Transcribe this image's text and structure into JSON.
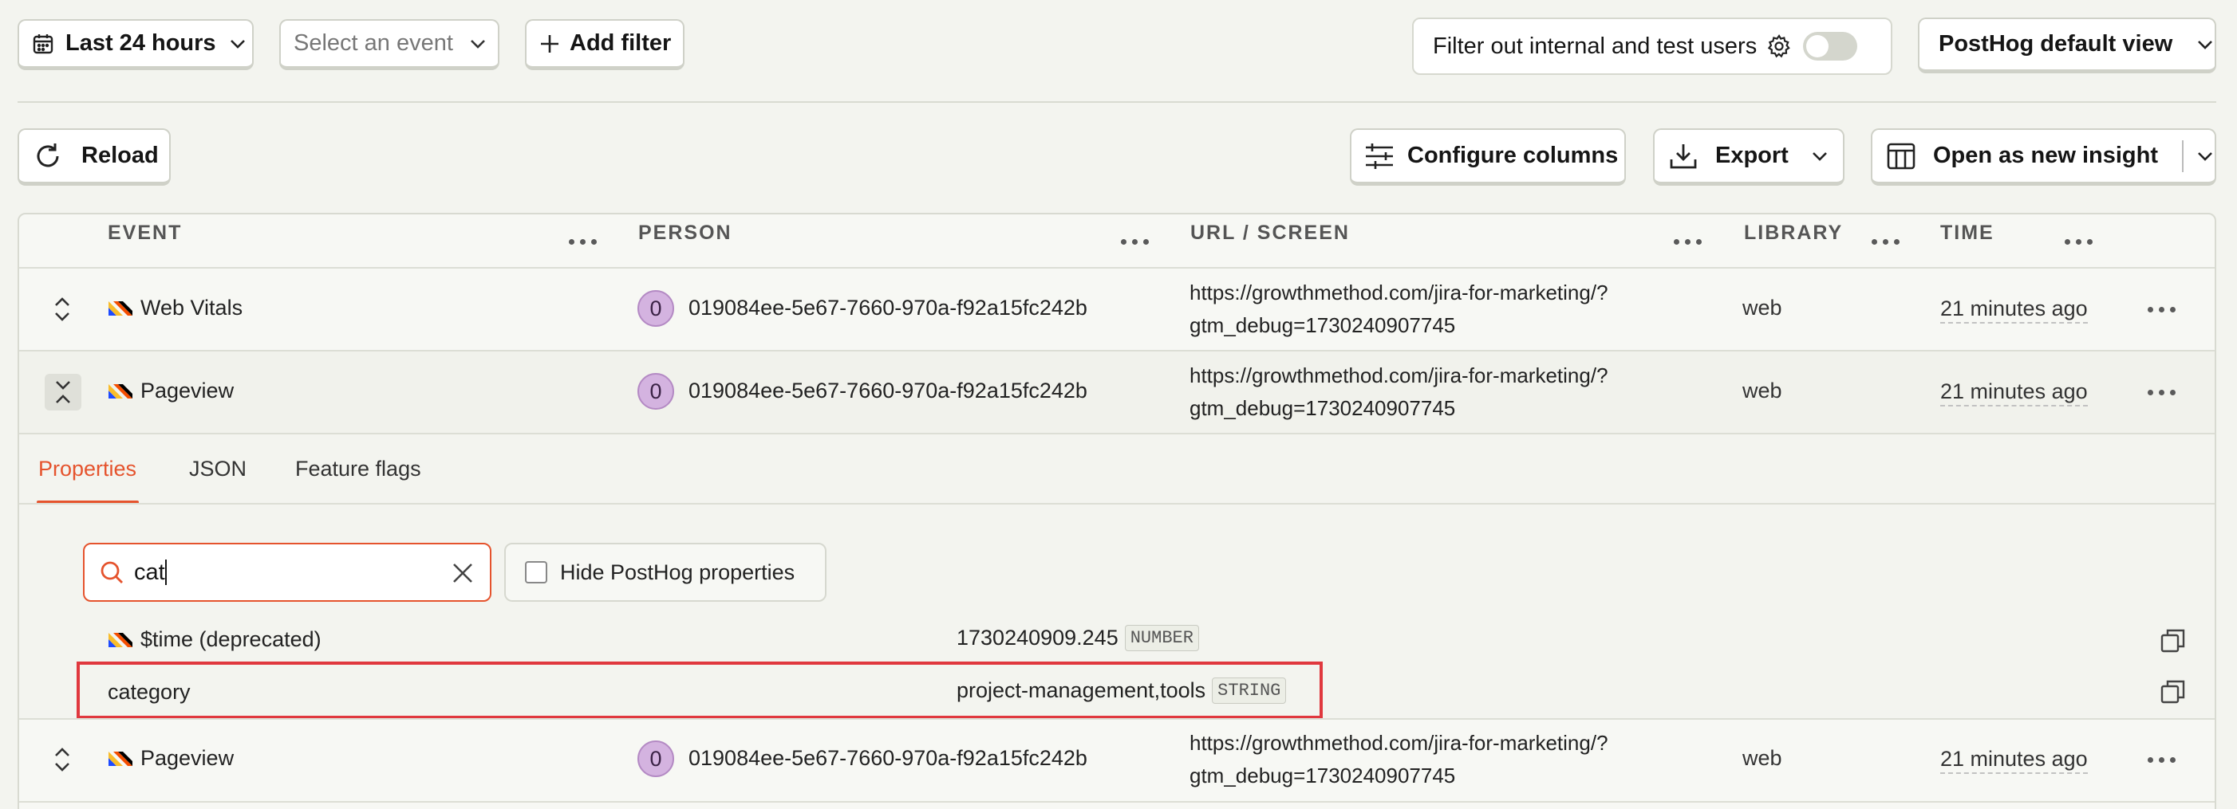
{
  "toolbar": {
    "date_range_label": "Last 24 hours",
    "event_select_placeholder": "Select an event",
    "add_filter_label": "Add filter",
    "filter_internal_label": "Filter out internal and test users",
    "view_label": "PostHog default view"
  },
  "actions": {
    "reload_label": "Reload",
    "configure_columns_label": "Configure columns",
    "export_label": "Export",
    "open_insight_label": "Open as new insight"
  },
  "table": {
    "headers": {
      "event": "EVENT",
      "person": "PERSON",
      "url": "URL / SCREEN",
      "library": "LIBRARY",
      "time": "TIME"
    },
    "rows": [
      {
        "event": "Web Vitals",
        "avatar": "0",
        "person": "019084ee-5e67-7660-970a-f92a15fc242b",
        "url_line1": "https://growthmethod.com/jira-for-marketing/?",
        "url_line2": "gtm_debug=1730240907745",
        "library": "web",
        "time": "21 minutes ago"
      },
      {
        "event": "Pageview",
        "avatar": "0",
        "person": "019084ee-5e67-7660-970a-f92a15fc242b",
        "url_line1": "https://growthmethod.com/jira-for-marketing/?",
        "url_line2": "gtm_debug=1730240907745",
        "library": "web",
        "time": "21 minutes ago"
      },
      {
        "event": "Pageview",
        "avatar": "0",
        "person": "019084ee-5e67-7660-970a-f92a15fc242b",
        "url_line1": "https://growthmethod.com/jira-for-marketing/?",
        "url_line2": "gtm_debug=1730240907745",
        "library": "web",
        "time": "21 minutes ago"
      }
    ]
  },
  "detail": {
    "tabs": [
      "Properties",
      "JSON",
      "Feature flags"
    ],
    "active_tab": "Properties",
    "search_value": "cat",
    "hide_posthog_label": "Hide PostHog properties",
    "properties": [
      {
        "name": "$time (deprecated)",
        "value": "1730240909.245",
        "type": "NUMBER"
      },
      {
        "name": "category",
        "value": "project-management,tools",
        "type": "STRING"
      }
    ]
  },
  "colors": {
    "accent": "#e5532d",
    "highlight_box": "#e0383e",
    "avatar_bg": "#d4b3e0"
  },
  "icons": [
    "calendar-icon",
    "chevron-down-icon",
    "plus-icon",
    "gear-icon",
    "toggle-switch",
    "reload-icon",
    "sliders-icon",
    "download-icon",
    "table-icon",
    "more-dots-icon",
    "expand-icon",
    "collapse-icon",
    "posthog-logo-icon",
    "search-icon",
    "clear-icon",
    "checkbox",
    "copy-icon"
  ]
}
